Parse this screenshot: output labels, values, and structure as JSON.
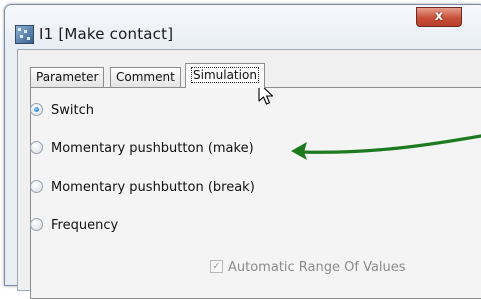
{
  "window": {
    "title": "I1 [Make contact]",
    "close_label": "x"
  },
  "tabs": [
    {
      "label": "Parameter"
    },
    {
      "label": "Comment"
    },
    {
      "label": "Simulation",
      "active": true
    }
  ],
  "options": [
    {
      "label": "Switch",
      "selected": true
    },
    {
      "label": "Momentary pushbutton (make)",
      "selected": false
    },
    {
      "label": "Momentary pushbutton (break)",
      "selected": false
    },
    {
      "label": "Frequency",
      "selected": false
    }
  ],
  "auto_range": {
    "label": "Automatic Range Of Values",
    "checked": true,
    "enabled": false
  },
  "annotation": {
    "arrow_color": "#1e7a1e",
    "points_to": "Momentary pushbutton (make)"
  }
}
